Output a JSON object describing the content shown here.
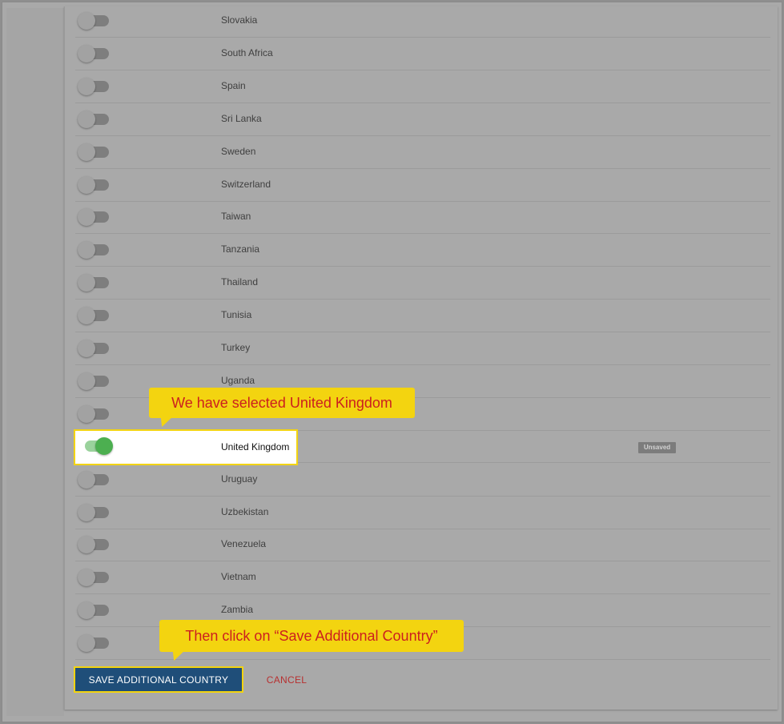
{
  "countries": [
    {
      "name": "Slovakia",
      "selected": false
    },
    {
      "name": "South Africa",
      "selected": false
    },
    {
      "name": "Spain",
      "selected": false
    },
    {
      "name": "Sri Lanka",
      "selected": false
    },
    {
      "name": "Sweden",
      "selected": false
    },
    {
      "name": "Switzerland",
      "selected": false
    },
    {
      "name": "Taiwan",
      "selected": false
    },
    {
      "name": "Tanzania",
      "selected": false
    },
    {
      "name": "Thailand",
      "selected": false
    },
    {
      "name": "Tunisia",
      "selected": false
    },
    {
      "name": "Turkey",
      "selected": false
    },
    {
      "name": "Uganda",
      "selected": false
    },
    {
      "name": "",
      "selected": false
    },
    {
      "name": "United Kingdom",
      "selected": true,
      "badge": "Unsaved"
    },
    {
      "name": "Uruguay",
      "selected": false
    },
    {
      "name": "Uzbekistan",
      "selected": false
    },
    {
      "name": "Venezuela",
      "selected": false
    },
    {
      "name": "Vietnam",
      "selected": false
    },
    {
      "name": "Zambia",
      "selected": false
    },
    {
      "name": "",
      "selected": false
    }
  ],
  "actions": {
    "save_label": "SAVE ADDITIONAL COUNTRY",
    "cancel_label": "CANCEL"
  },
  "callouts": {
    "selected": "We have selected United Kingdom",
    "save": "Then click on “Save Additional Country”"
  },
  "colors": {
    "toggle_on": "#4caf50",
    "primary_button": "#1f4e79",
    "cancel_text": "#b73030",
    "callout_bg": "#f3d410",
    "callout_text": "#cc1f1f"
  }
}
